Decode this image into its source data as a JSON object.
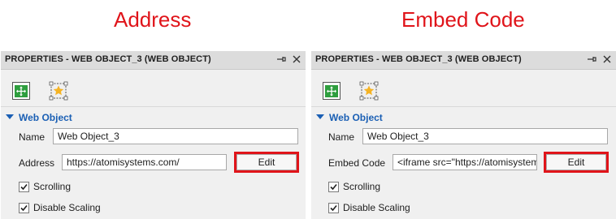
{
  "captions": {
    "left": "Address",
    "right": "Embed Code"
  },
  "left_panel": {
    "title": "PROPERTIES - WEB OBJECT_3 (WEB OBJECT)",
    "section": "Web Object",
    "name_label": "Name",
    "name_value": "Web Object_3",
    "field_label": "Address",
    "field_value": "https://atomisystems.com/",
    "edit_label": "Edit",
    "scrolling_label": "Scrolling",
    "disable_scaling_label": "Disable Scaling"
  },
  "right_panel": {
    "title": "PROPERTIES - WEB OBJECT_3 (WEB OBJECT)",
    "section": "Web Object",
    "name_label": "Name",
    "name_value": "Web Object_3",
    "field_label": "Embed Code",
    "field_value": "<iframe src=\"https://atomisystems.com/\"",
    "edit_label": "Edit",
    "scrolling_label": "Scrolling",
    "disable_scaling_label": "Disable Scaling"
  },
  "icons": {
    "pin": "pin-icon",
    "close": "close-icon",
    "tab_web_object": "web-object-move-icon",
    "tab_favorite": "star-frame-icon",
    "checkbox": "checkmark-icon"
  },
  "colors": {
    "highlight": "#e0141a",
    "section_title": "#1a5fb4",
    "panel_bg": "#f0f0f0",
    "titlebar_bg": "#dcdcdc"
  },
  "state": {
    "scrolling_checked": true,
    "disable_scaling_checked": true
  }
}
